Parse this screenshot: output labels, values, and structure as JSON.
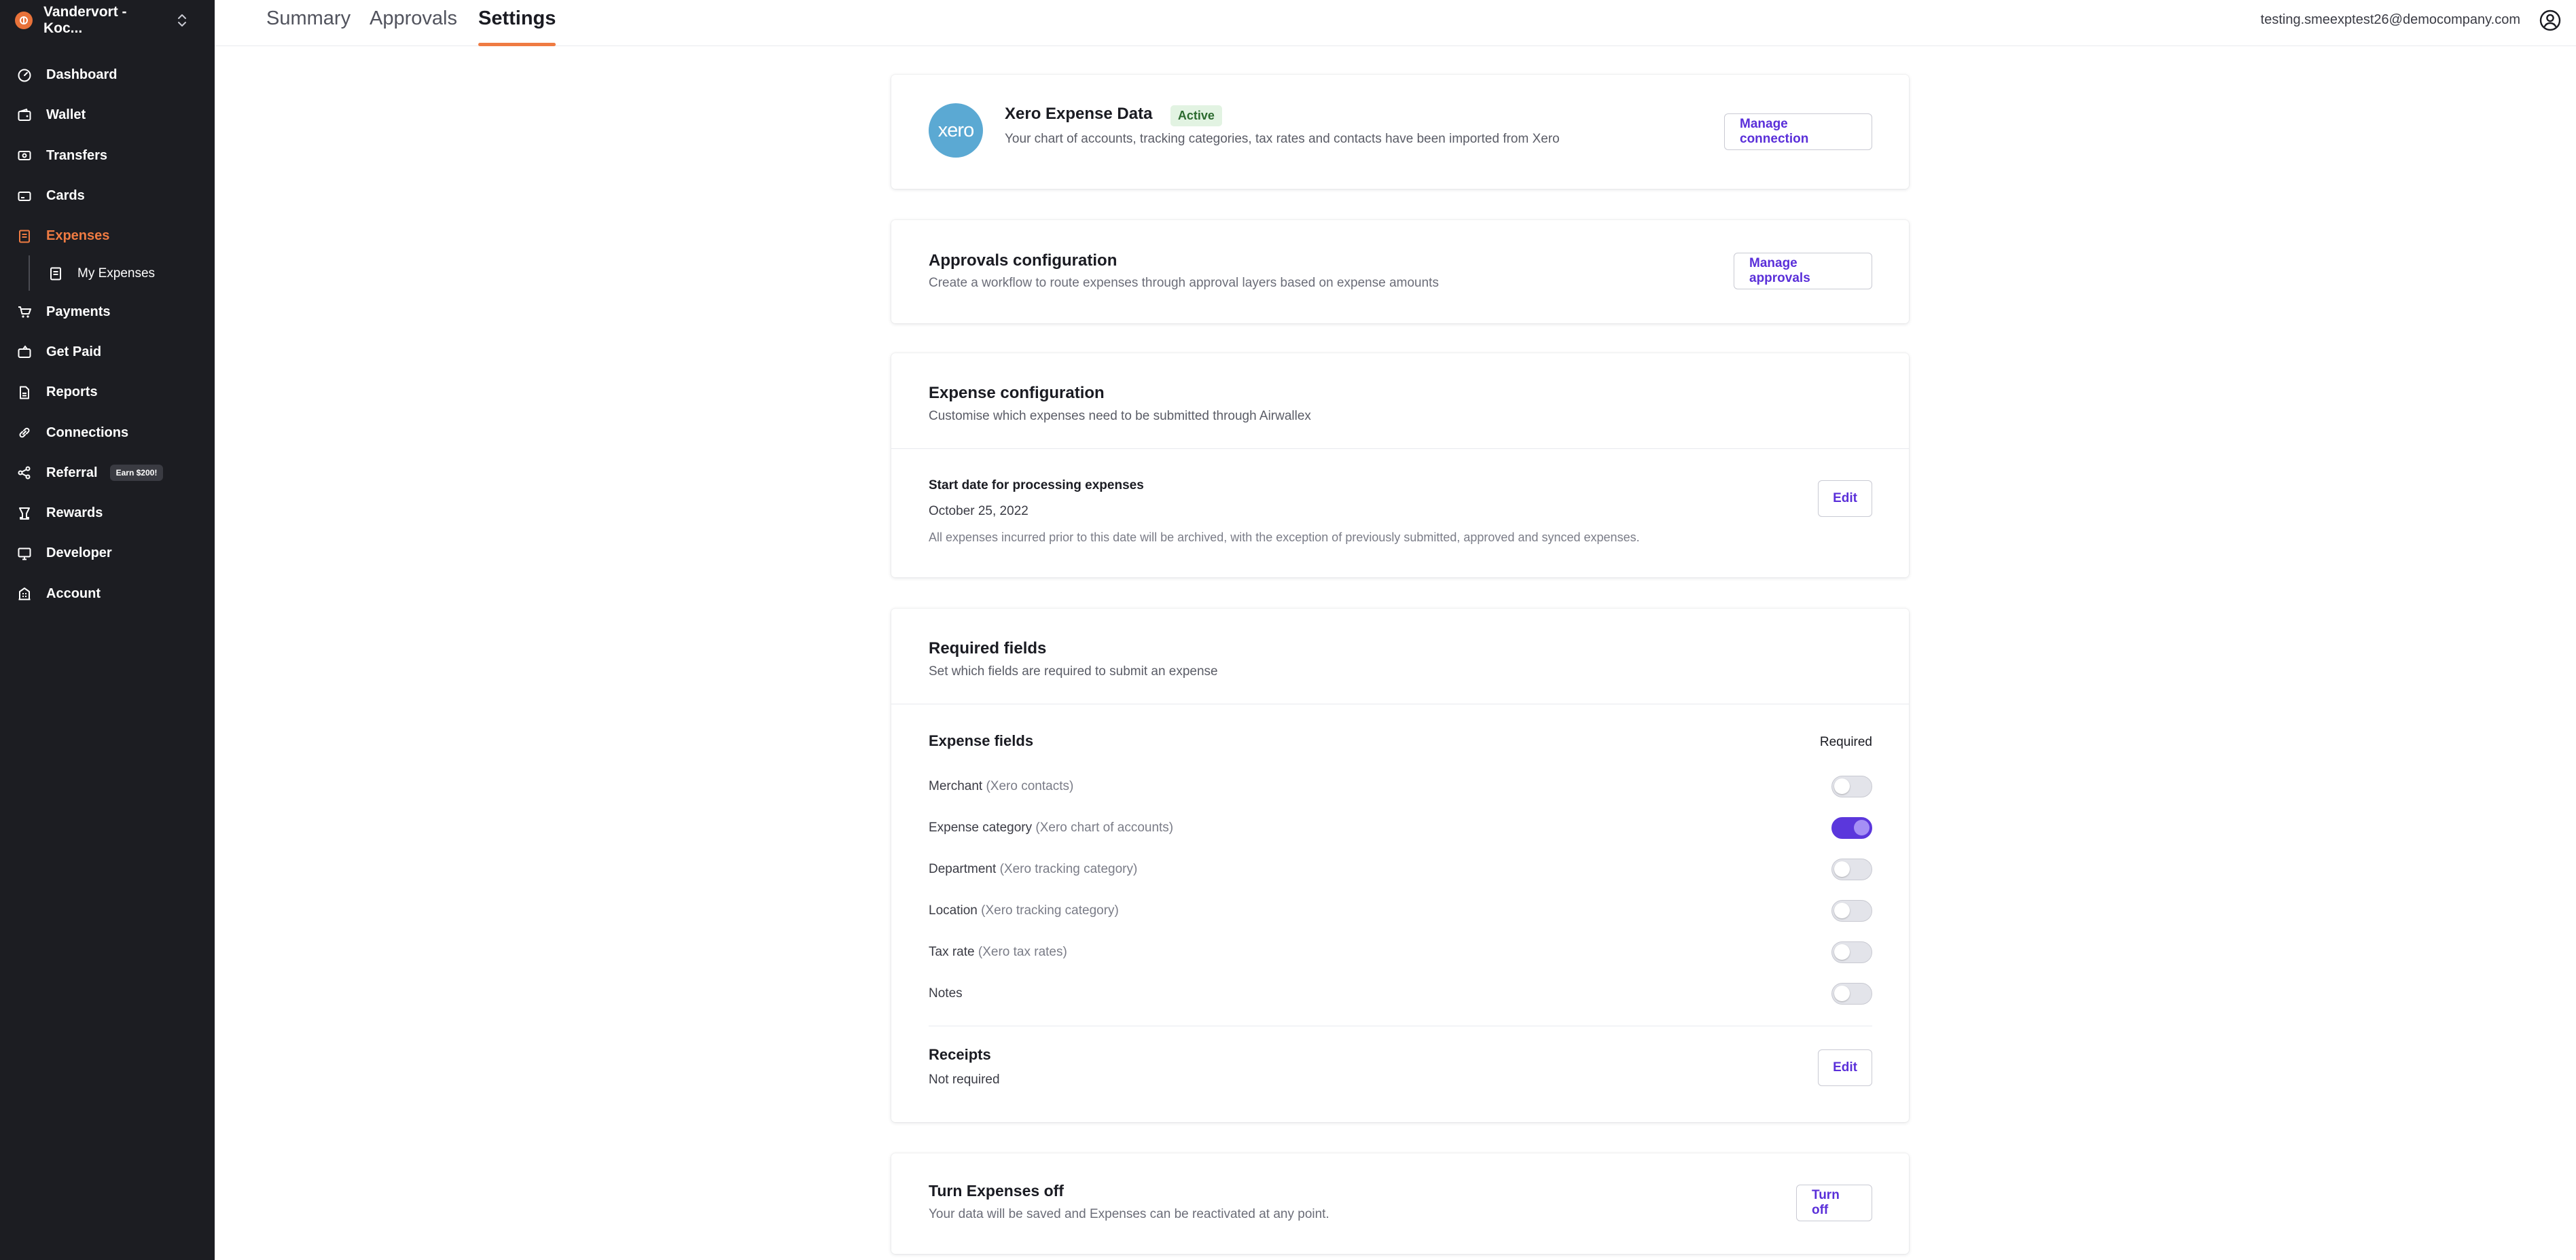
{
  "org": {
    "name": "Vandervort - Koc..."
  },
  "nav": {
    "items": [
      {
        "label": "Dashboard",
        "icon": "dashboard-icon"
      },
      {
        "label": "Wallet",
        "icon": "wallet-icon"
      },
      {
        "label": "Transfers",
        "icon": "transfers-icon"
      },
      {
        "label": "Cards",
        "icon": "cards-icon"
      },
      {
        "label": "Expenses",
        "icon": "expenses-icon",
        "active": true
      },
      {
        "label": "My Expenses",
        "icon": "receipt-icon",
        "sub": true
      },
      {
        "label": "Payments",
        "icon": "payments-icon"
      },
      {
        "label": "Get Paid",
        "icon": "get-paid-icon"
      },
      {
        "label": "Reports",
        "icon": "reports-icon"
      },
      {
        "label": "Connections",
        "icon": "link-icon"
      },
      {
        "label": "Referral",
        "icon": "share-icon",
        "badge": "Earn $200!"
      },
      {
        "label": "Rewards",
        "icon": "trophy-icon"
      },
      {
        "label": "Developer",
        "icon": "monitor-icon"
      },
      {
        "label": "Account",
        "icon": "building-icon"
      }
    ]
  },
  "header": {
    "tabs": [
      {
        "label": "Summary"
      },
      {
        "label": "Approvals"
      },
      {
        "label": "Settings",
        "active": true
      }
    ],
    "user_email": "testing.smeexptest26@democompany.com"
  },
  "xero": {
    "logo_text": "xero",
    "title": "Xero Expense Data",
    "status": "Active",
    "desc": "Your chart of accounts, tracking categories, tax rates and contacts have been imported from Xero",
    "button": "Manage connection"
  },
  "approvals": {
    "title": "Approvals configuration",
    "desc": "Create a workflow to route expenses through approval layers based on expense amounts",
    "button": "Manage approvals"
  },
  "expense_config": {
    "title": "Expense configuration",
    "desc": "Customise which expenses need to be submitted through Airwallex",
    "start_label": "Start date for processing expenses",
    "start_date": "October 25, 2022",
    "note": "All expenses incurred prior to this date will be archived, with the exception of previously submitted, approved and synced expenses.",
    "button": "Edit"
  },
  "required_fields": {
    "title": "Required fields",
    "desc": "Set which fields are required to submit an expense",
    "section_title": "Expense fields",
    "required_header": "Required",
    "fields": [
      {
        "label": "Merchant",
        "hint": "(Xero contacts)",
        "required": false
      },
      {
        "label": "Expense category",
        "hint": "(Xero chart of accounts)",
        "required": true
      },
      {
        "label": "Department",
        "hint": "(Xero tracking category)",
        "required": false
      },
      {
        "label": "Location",
        "hint": "(Xero tracking category)",
        "required": false
      },
      {
        "label": "Tax rate",
        "hint": "(Xero tax rates)",
        "required": false
      },
      {
        "label": "Notes",
        "hint": "",
        "required": false
      }
    ],
    "receipts_title": "Receipts",
    "receipts_value": "Not required",
    "receipts_button": "Edit"
  },
  "turn_off": {
    "title": "Turn Expenses off",
    "desc": "Your data will be saved and Expenses can be reactivated at any point.",
    "button": "Turn off"
  },
  "colors": {
    "accent_orange": "#ef7b42",
    "accent_purple": "#5b37dc",
    "sidebar_bg": "#1c1d22",
    "xero_blue": "#5ba9d3"
  }
}
